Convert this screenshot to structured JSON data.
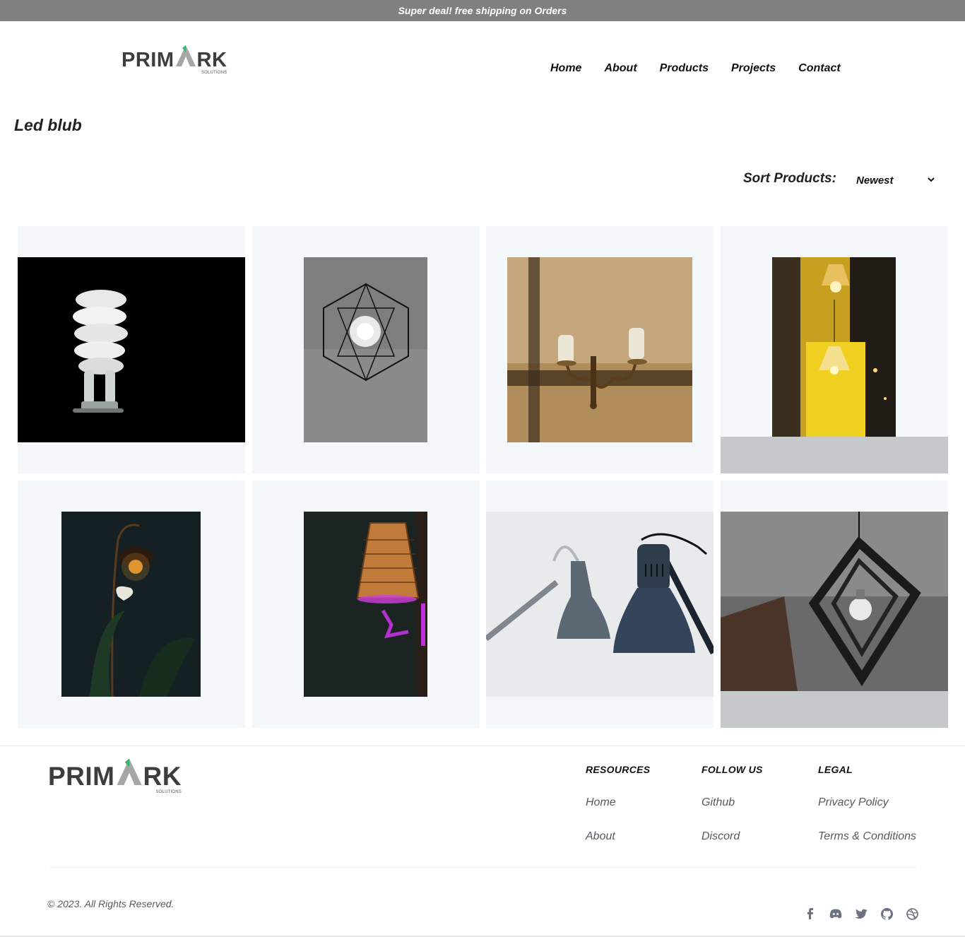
{
  "topbar": {
    "text": "Super deal! free shipping on Orders"
  },
  "brand": {
    "name_left": "PRIM",
    "name_right": "RK",
    "sub": "SOLUTIONS",
    "colors": {
      "dark": "#3d3d3d",
      "gray": "#a6a6a6",
      "red": "#e0245e",
      "green": "#3cb371",
      "blue": "#1e90ff"
    }
  },
  "nav": [
    {
      "label": "Home"
    },
    {
      "label": "About"
    },
    {
      "label": "Products"
    },
    {
      "label": "Projects"
    },
    {
      "label": "Contact"
    }
  ],
  "page": {
    "title": "Led blub"
  },
  "sort": {
    "label": "Sort Products:",
    "selected": "Newest"
  },
  "products": [
    {
      "image": "spiral-cfl-bulb"
    },
    {
      "image": "geometric-pendant-lamp"
    },
    {
      "image": "wall-chandelier"
    },
    {
      "image": "yellow-hallway-pendants"
    },
    {
      "image": "floor-lamp-with-plant"
    },
    {
      "image": "lampshade-purple-light"
    },
    {
      "image": "blue-desk-lamps"
    },
    {
      "image": "diamond-cage-pendant"
    }
  ],
  "footer": {
    "columns": [
      {
        "heading": "RESOURCES",
        "links": [
          "Home",
          "About"
        ]
      },
      {
        "heading": "FOLLOW US",
        "links": [
          "Github",
          "Discord"
        ]
      },
      {
        "heading": "LEGAL",
        "links": [
          "Privacy Policy",
          "Terms & Conditions"
        ]
      }
    ],
    "copyright": "© 2023. All Rights Reserved.",
    "socials": [
      "facebook-icon",
      "discord-icon",
      "twitter-icon",
      "github-icon",
      "dribbble-icon"
    ]
  }
}
